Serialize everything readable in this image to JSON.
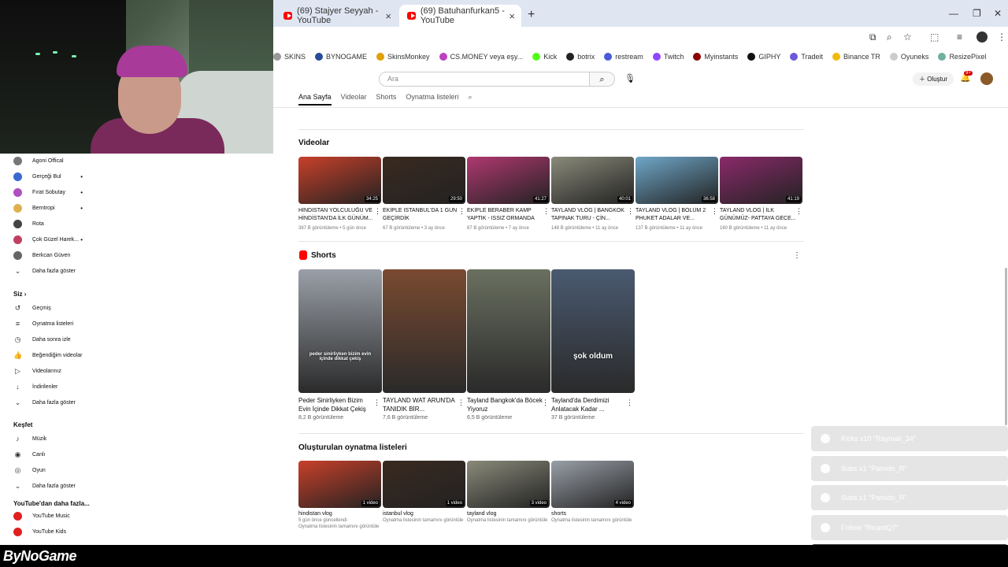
{
  "browser": {
    "tabs": [
      {
        "title": "(69) Stajyer Seyyah - YouTube",
        "active": false
      },
      {
        "title": "(69) Batuhanfurkan5 - YouTube",
        "active": true
      }
    ],
    "bookmarks": [
      {
        "label": "SKINS",
        "color": "#999999"
      },
      {
        "label": "BYNOGAME",
        "color": "#2a4a9a"
      },
      {
        "label": "SkinsMonkey",
        "color": "#e0a000"
      },
      {
        "label": "CS.MONEY veya eşy...",
        "color": "#c040c0"
      },
      {
        "label": "Kick",
        "color": "#53fc18"
      },
      {
        "label": "botrix",
        "color": "#222222"
      },
      {
        "label": "restream",
        "color": "#4a5ad8"
      },
      {
        "label": "Twitch",
        "color": "#9146ff"
      },
      {
        "label": "Myinstants",
        "color": "#8b0000"
      },
      {
        "label": "GIPHY",
        "color": "#111111"
      },
      {
        "label": "Tradeit",
        "color": "#6a5ad8"
      },
      {
        "label": "Binance TR",
        "color": "#f0b90b"
      },
      {
        "label": "Oyuneks",
        "color": "#cccccc"
      },
      {
        "label": "ResizePixel",
        "color": "#70b0a0"
      }
    ]
  },
  "youtube": {
    "search_placeholder": "Ara",
    "create_label": "Oluştur",
    "notif_count": "9+",
    "channel_tabs": [
      "Ana Sayfa",
      "Videolar",
      "Shorts",
      "Oynatma listeleri"
    ],
    "videos_title": "Videolar",
    "videos": [
      {
        "title": "HİNDİSTAN YOLCULUĞU VE HİNDİSTAN'DA İLK GÜNÜM...",
        "meta": "387 B görüntüleme • 5 gün önce",
        "duration": "34:25",
        "color": "#c8402a"
      },
      {
        "title": "EKİPLE İSTANBUL'DA 1 GÜN GEÇİRDİK",
        "meta": "67 B görüntüleme • 3 ay önce",
        "duration": "29:50",
        "color": "#3a2a20"
      },
      {
        "title": "EKİPLE BERABER KAMP YAPTIK - ISSIZ ORMANDA 1...",
        "meta": "87 B görüntüleme • 7 ay önce",
        "duration": "41:27",
        "color": "#b03870"
      },
      {
        "title": "TAYLAND VLOG | BANGKOK TAPINAK TURU - ÇİN...",
        "meta": "148 B görüntüleme • 11 ay önce",
        "duration": "40:01",
        "color": "#8a8a7a"
      },
      {
        "title": "TAYLAND VLOG | BÖLÜM 2 PHUKET ADALAR VE...",
        "meta": "137 B görüntüleme • 11 ay önce",
        "duration": "36:58",
        "color": "#6fa7c8"
      },
      {
        "title": "TAYLAND VLOG | İLK GÜNÜMÜZ- PATTAYA GECE...",
        "meta": "160 B görüntüleme • 11 ay önce",
        "duration": "41:19",
        "color": "#8a2a6a"
      }
    ],
    "shorts_title": "Shorts",
    "shorts": [
      {
        "title": "Peder Sinirliyken Bizim Evin İçinde Dikkat Çekiş",
        "meta": "8,2 B görüntüleme",
        "caption": "peder sinirliyken bizim evin içinde dikkat çekiş",
        "color": "#9aa0a8"
      },
      {
        "title": "TAYLAND WAT ARUN'DA TANIDIK BİR...",
        "meta": "7,6 B görüntüleme",
        "caption": "",
        "color": "#7a4a30"
      },
      {
        "title": "Tayland Bangkok'da Böcek Yiyoruz",
        "meta": "6,5 B görüntüleme",
        "caption": "",
        "color": "#6a7060"
      },
      {
        "title": "Tayland'da Derdimizi Anlatacak Kadar ...",
        "meta": "37 B görüntüleme",
        "caption": "şok oldum",
        "color": "#4a5a70"
      }
    ],
    "playlists_title": "Oluşturulan oynatma listeleri",
    "playlists": [
      {
        "title": "hindistan vlog",
        "meta1": "5 gün önce güncellendi",
        "meta2": "Oynatma listesinin tamamını görüntüle",
        "count": "1 video",
        "color": "#c8402a"
      },
      {
        "title": "istanbul vlog",
        "meta1": "Oynatma listesinin tamamını görüntüle",
        "meta2": "",
        "count": "1 video",
        "color": "#3a2a20"
      },
      {
        "title": "tayland vlog",
        "meta1": "Oynatma listesinin tamamını görüntüle",
        "meta2": "",
        "count": "3 video",
        "color": "#8a8a7a"
      },
      {
        "title": "shorts",
        "meta1": "Oynatma listesinin tamamını görüntüle",
        "meta2": "",
        "count": "4 video",
        "color": "#9aa0a8"
      }
    ]
  },
  "sidebar": {
    "subs": [
      {
        "label": "Agoni Offical",
        "dot": false,
        "color": "#777777"
      },
      {
        "label": "Gerçeği Bul",
        "dot": true,
        "color": "#3a6ad0"
      },
      {
        "label": "Fırat Sobutay",
        "dot": true,
        "color": "#b050c0"
      },
      {
        "label": "Berntropi",
        "dot": true,
        "color": "#e0b050"
      },
      {
        "label": "Rota",
        "dot": false,
        "color": "#444444"
      },
      {
        "label": "Çok Güzel Harek...",
        "dot": true,
        "color": "#c04060"
      },
      {
        "label": "Berkcan Güven",
        "dot": false,
        "color": "#666666"
      }
    ],
    "show_more": "Daha fazla göster",
    "you_head": "Siz",
    "you_items": [
      "Geçmiş",
      "Oynatma listeleri",
      "Daha sonra izle",
      "Beğendiğim videolar",
      "Videolarınız",
      "İndirilenler",
      "Daha fazla göster"
    ],
    "explore_head": "Keşfet",
    "explore_items": [
      "Müzik",
      "Canlı",
      "Oyun",
      "Daha fazla göster"
    ],
    "more_head": "YouTube'dan daha fazla...",
    "more_items": [
      "YouTube Music",
      "YouTube Kids"
    ]
  },
  "alerts": [
    {
      "text": "Kicks x10 \"Raymali_34\"",
      "dark": false
    },
    {
      "text": "Subs x1 \"Pamido_R\"",
      "dark": false
    },
    {
      "text": "Subs x1 \"Pamido_R\"",
      "dark": false
    },
    {
      "text": "Follow \"RicardQ7\"",
      "dark": false
    },
    {
      "text": "Kicks x10 \"Raymali_34\"",
      "dark": true
    }
  ],
  "overlay_logo": "ByNoGame"
}
